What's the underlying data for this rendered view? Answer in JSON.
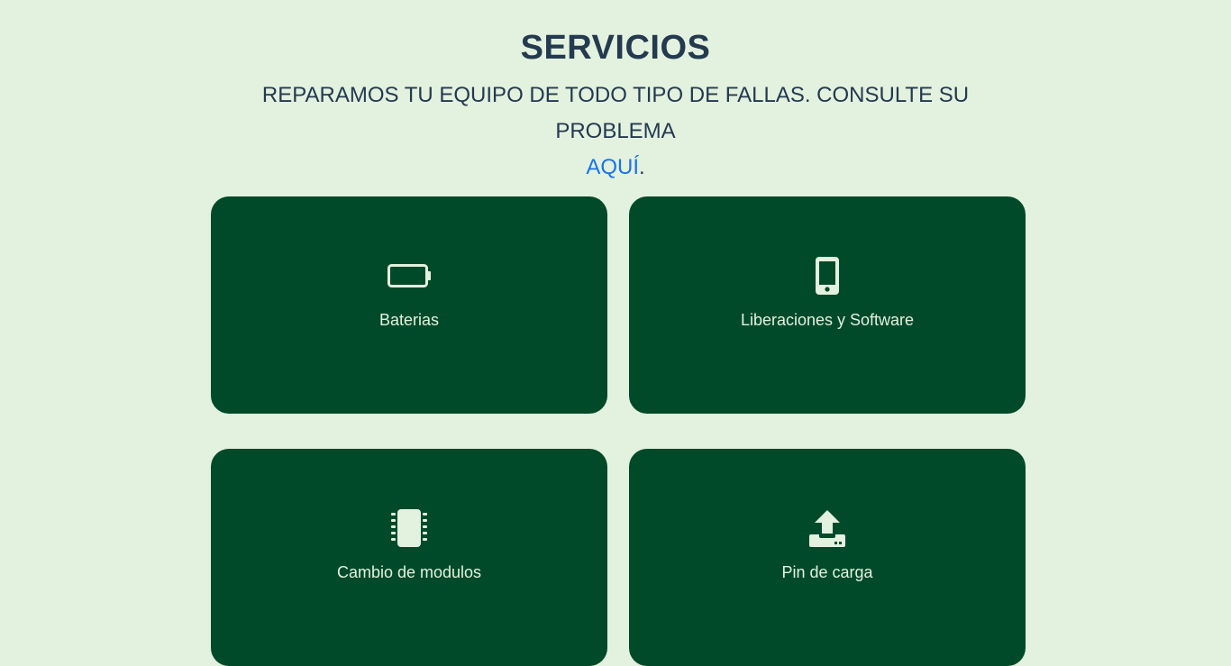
{
  "header": {
    "title": "SERVICIOS",
    "subtitle": "REPARAMOS TU EQUIPO DE TODO TIPO DE FALLAS. CONSULTE SU PROBLEMA",
    "link_label": "AQUÍ",
    "period": "."
  },
  "services": [
    {
      "label": "Baterias",
      "icon": "battery-icon"
    },
    {
      "label": "Liberaciones y Software",
      "icon": "mobile-phone-icon"
    },
    {
      "label": "Cambio de modulos",
      "icon": "chip-icon"
    },
    {
      "label": "Pin de carga",
      "icon": "upload-icon"
    }
  ],
  "colors": {
    "background": "#e3f1df",
    "card": "#004a29",
    "card_text": "#e3f1df",
    "heading": "#233a4f",
    "link": "#1a73e8"
  }
}
